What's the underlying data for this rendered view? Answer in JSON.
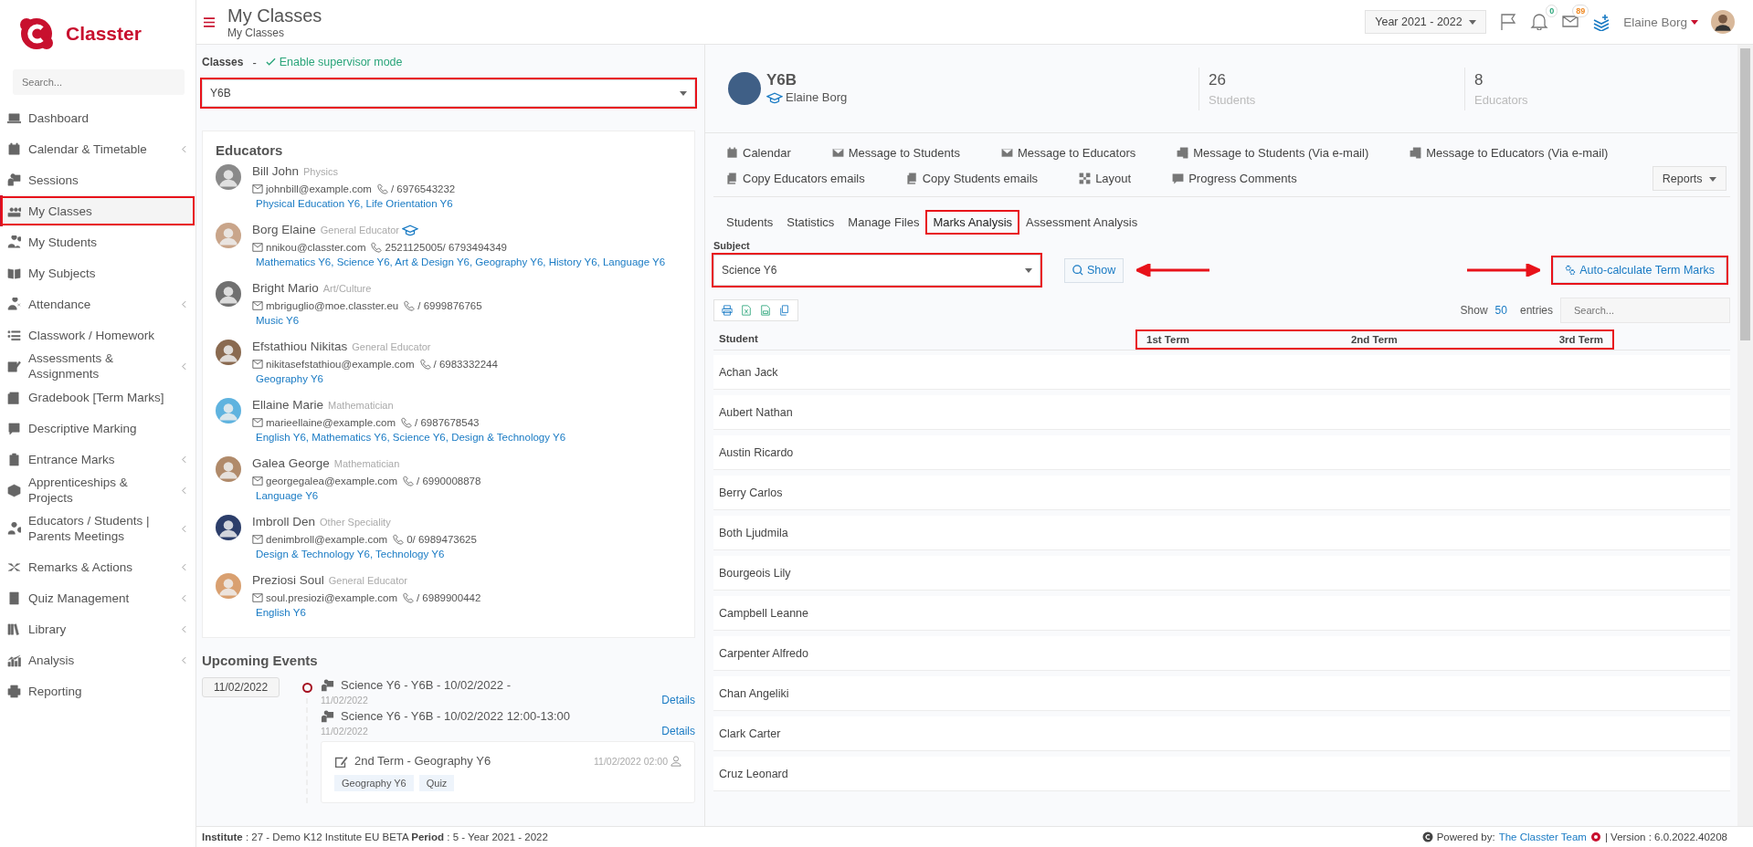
{
  "app": {
    "logo_text": "Classter",
    "search_placeholder": "Search..."
  },
  "sidebar": {
    "items": [
      {
        "label": "Dashboard",
        "expandable": false,
        "selected": false,
        "highlighted": false
      },
      {
        "label": "Calendar & Timetable",
        "expandable": true,
        "selected": false,
        "highlighted": false
      },
      {
        "label": "Sessions",
        "expandable": false,
        "selected": false,
        "highlighted": false
      },
      {
        "label": "My Classes",
        "expandable": false,
        "selected": true,
        "highlighted": true
      },
      {
        "label": "My Students",
        "expandable": false,
        "selected": false,
        "highlighted": false
      },
      {
        "label": "My Subjects",
        "expandable": false,
        "selected": false,
        "highlighted": false
      },
      {
        "label": "Attendance",
        "expandable": true,
        "selected": false,
        "highlighted": false
      },
      {
        "label": "Classwork / Homework",
        "expandable": false,
        "selected": false,
        "highlighted": false
      },
      {
        "label": "Assessments & Assignments",
        "expandable": true,
        "selected": false,
        "highlighted": false
      },
      {
        "label": "Gradebook [Term Marks]",
        "expandable": false,
        "selected": false,
        "highlighted": false
      },
      {
        "label": "Descriptive Marking",
        "expandable": false,
        "selected": false,
        "highlighted": false
      },
      {
        "label": "Entrance Marks",
        "expandable": true,
        "selected": false,
        "highlighted": false
      },
      {
        "label": "Apprenticeships & Projects",
        "expandable": true,
        "selected": false,
        "highlighted": false
      },
      {
        "label": "Educators / Students | Parents Meetings",
        "expandable": true,
        "selected": false,
        "highlighted": false
      },
      {
        "label": "Remarks & Actions",
        "expandable": true,
        "selected": false,
        "highlighted": false
      },
      {
        "label": "Quiz Management",
        "expandable": true,
        "selected": false,
        "highlighted": false
      },
      {
        "label": "Library",
        "expandable": true,
        "selected": false,
        "highlighted": false
      },
      {
        "label": "Analysis",
        "expandable": true,
        "selected": false,
        "highlighted": false
      },
      {
        "label": "Reporting",
        "expandable": false,
        "selected": false,
        "highlighted": false
      }
    ]
  },
  "header": {
    "title": "My Classes",
    "breadcrumb": "My Classes",
    "year": "Year 2021 - 2022",
    "notifications": "0",
    "messages": "89",
    "user": "Elaine Borg"
  },
  "left": {
    "classes_label": "Classes",
    "separator": "-",
    "supervisor_link": "Enable supervisor mode",
    "class_select": {
      "value": "Y6B",
      "highlighted": true
    },
    "educators": {
      "title": "Educators",
      "items": [
        {
          "name": "Bill John",
          "role": "Physics",
          "head": false,
          "email": "johnbill@example.com",
          "phone": "/ 6976543232",
          "subjects": "Physical Education Y6, Life Orientation Y6"
        },
        {
          "name": "Borg Elaine",
          "role": "General Educator",
          "head": true,
          "email": "nnikou@classter.com",
          "phone": "2521125005/ 6793494349",
          "subjects": "Mathematics Y6, Science Y6, Art & Design Y6, Geography Y6, History Y6, Language Y6"
        },
        {
          "name": "Bright Mario",
          "role": "Art/Culture",
          "head": false,
          "email": "mbriguglio@moe.classter.eu",
          "phone": "/ 6999876765",
          "subjects": "Music Y6"
        },
        {
          "name": "Efstathiou Nikitas",
          "role": "General Educator",
          "head": false,
          "email": "nikitasefstathiou@example.com",
          "phone": "/ 6983332244",
          "subjects": "Geography Y6"
        },
        {
          "name": "Ellaine Marie",
          "role": "Mathematician",
          "head": false,
          "email": "marieellaine@example.com",
          "phone": "/ 6987678543",
          "subjects": "English Y6, Mathematics Y6, Science Y6, Design & Technology Y6"
        },
        {
          "name": "Galea George",
          "role": "Mathematician",
          "head": false,
          "email": "georgegalea@example.com",
          "phone": "/ 6990008878",
          "subjects": "Language Y6"
        },
        {
          "name": "Imbroll Den",
          "role": "Other Speciality",
          "head": false,
          "email": "denimbroll@example.com",
          "phone": "0/ 6989473625",
          "subjects": "Design & Technology Y6, Technology Y6"
        },
        {
          "name": "Preziosi Soul",
          "role": "General Educator",
          "head": false,
          "email": "soul.presiozi@example.com",
          "phone": "/ 6989900442",
          "subjects": "English Y6"
        }
      ]
    },
    "upcoming": {
      "title": "Upcoming Events",
      "date": "11/02/2022",
      "events": [
        {
          "title": "Science Y6 - Y6B - 10/02/2022 -",
          "date": "11/02/2022",
          "link": "Details"
        },
        {
          "title": "Science Y6 - Y6B - 10/02/2022 12:00-13:00",
          "date": "11/02/2022",
          "link": "Details"
        }
      ],
      "assessment": {
        "title": "2nd Term - Geography Y6",
        "datetime": "11/02/2022 02:00",
        "tags": [
          "Geography Y6",
          "Quiz"
        ]
      }
    }
  },
  "right": {
    "class_card": {
      "name": "Y6B",
      "teacher": "Elaine Borg",
      "stats": [
        {
          "value": "26",
          "label": "Students"
        },
        {
          "value": "8",
          "label": "Educators"
        }
      ]
    },
    "actions": [
      "Calendar",
      "Message to Students",
      "Message to Educators",
      "Message to Students (Via e-mail)",
      "Message to Educators (Via e-mail)",
      "Copy Educators emails",
      "Copy Students emails",
      "Layout",
      "Progress Comments"
    ],
    "reports": "Reports",
    "tabs": [
      {
        "label": "Students",
        "selected": false,
        "highlighted": false
      },
      {
        "label": "Statistics",
        "selected": false,
        "highlighted": false
      },
      {
        "label": "Manage Files",
        "selected": false,
        "highlighted": false
      },
      {
        "label": "Marks Analysis",
        "selected": true,
        "highlighted": true
      },
      {
        "label": "Assessment Analysis",
        "selected": false,
        "highlighted": false
      }
    ],
    "subject_label": "Subject",
    "subject_select": {
      "value": "Science Y6",
      "highlighted": true
    },
    "show_button": {
      "label": "Show",
      "pointer_arrow": true
    },
    "auto_button": {
      "label": "Auto-calculate Term Marks",
      "highlighted": true,
      "pointer_arrow": true
    },
    "table": {
      "show": "Show",
      "page_size": "50",
      "entries": "entries",
      "search_placeholder": "Search...",
      "student_column": "Student",
      "term_columns": {
        "highlighted": true,
        "labels": [
          "1st Term",
          "2nd Term",
          "3rd Term"
        ]
      },
      "rows": [
        "Achan Jack",
        "Aubert Nathan",
        "Austin Ricardo",
        "Berry Carlos",
        "Both Ljudmila",
        "Bourgeois Lily",
        "Campbell Leanne",
        "Carpenter Alfredo",
        "Chan Angeliki",
        "Clark Carter",
        "Cruz Leonard"
      ]
    }
  },
  "footer": {
    "info": "**Institute** : 27 - Demo K12 Institute EU BETA **Period** : 5 - Year 2021 - 2022",
    "powered": "Powered by:",
    "team_link": "The Classter Team",
    "version": "| Version : 6.0.2022.40208"
  }
}
